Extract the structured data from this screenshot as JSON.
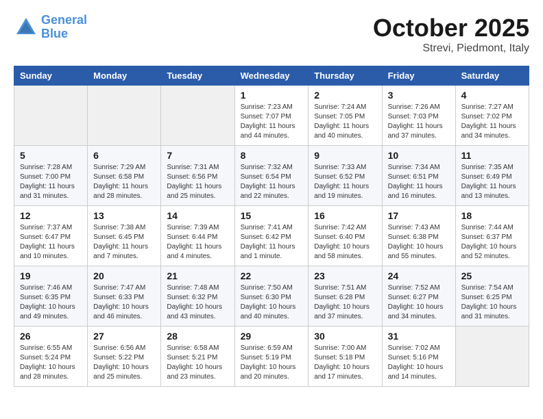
{
  "header": {
    "logo_line1": "General",
    "logo_line2": "Blue",
    "month": "October 2025",
    "location": "Strevi, Piedmont, Italy"
  },
  "weekdays": [
    "Sunday",
    "Monday",
    "Tuesday",
    "Wednesday",
    "Thursday",
    "Friday",
    "Saturday"
  ],
  "weeks": [
    [
      {
        "day": "",
        "info": ""
      },
      {
        "day": "",
        "info": ""
      },
      {
        "day": "",
        "info": ""
      },
      {
        "day": "1",
        "info": "Sunrise: 7:23 AM\nSunset: 7:07 PM\nDaylight: 11 hours and 44 minutes."
      },
      {
        "day": "2",
        "info": "Sunrise: 7:24 AM\nSunset: 7:05 PM\nDaylight: 11 hours and 40 minutes."
      },
      {
        "day": "3",
        "info": "Sunrise: 7:26 AM\nSunset: 7:03 PM\nDaylight: 11 hours and 37 minutes."
      },
      {
        "day": "4",
        "info": "Sunrise: 7:27 AM\nSunset: 7:02 PM\nDaylight: 11 hours and 34 minutes."
      }
    ],
    [
      {
        "day": "5",
        "info": "Sunrise: 7:28 AM\nSunset: 7:00 PM\nDaylight: 11 hours and 31 minutes."
      },
      {
        "day": "6",
        "info": "Sunrise: 7:29 AM\nSunset: 6:58 PM\nDaylight: 11 hours and 28 minutes."
      },
      {
        "day": "7",
        "info": "Sunrise: 7:31 AM\nSunset: 6:56 PM\nDaylight: 11 hours and 25 minutes."
      },
      {
        "day": "8",
        "info": "Sunrise: 7:32 AM\nSunset: 6:54 PM\nDaylight: 11 hours and 22 minutes."
      },
      {
        "day": "9",
        "info": "Sunrise: 7:33 AM\nSunset: 6:52 PM\nDaylight: 11 hours and 19 minutes."
      },
      {
        "day": "10",
        "info": "Sunrise: 7:34 AM\nSunset: 6:51 PM\nDaylight: 11 hours and 16 minutes."
      },
      {
        "day": "11",
        "info": "Sunrise: 7:35 AM\nSunset: 6:49 PM\nDaylight: 11 hours and 13 minutes."
      }
    ],
    [
      {
        "day": "12",
        "info": "Sunrise: 7:37 AM\nSunset: 6:47 PM\nDaylight: 11 hours and 10 minutes."
      },
      {
        "day": "13",
        "info": "Sunrise: 7:38 AM\nSunset: 6:45 PM\nDaylight: 11 hours and 7 minutes."
      },
      {
        "day": "14",
        "info": "Sunrise: 7:39 AM\nSunset: 6:44 PM\nDaylight: 11 hours and 4 minutes."
      },
      {
        "day": "15",
        "info": "Sunrise: 7:41 AM\nSunset: 6:42 PM\nDaylight: 11 hours and 1 minute."
      },
      {
        "day": "16",
        "info": "Sunrise: 7:42 AM\nSunset: 6:40 PM\nDaylight: 10 hours and 58 minutes."
      },
      {
        "day": "17",
        "info": "Sunrise: 7:43 AM\nSunset: 6:38 PM\nDaylight: 10 hours and 55 minutes."
      },
      {
        "day": "18",
        "info": "Sunrise: 7:44 AM\nSunset: 6:37 PM\nDaylight: 10 hours and 52 minutes."
      }
    ],
    [
      {
        "day": "19",
        "info": "Sunrise: 7:46 AM\nSunset: 6:35 PM\nDaylight: 10 hours and 49 minutes."
      },
      {
        "day": "20",
        "info": "Sunrise: 7:47 AM\nSunset: 6:33 PM\nDaylight: 10 hours and 46 minutes."
      },
      {
        "day": "21",
        "info": "Sunrise: 7:48 AM\nSunset: 6:32 PM\nDaylight: 10 hours and 43 minutes."
      },
      {
        "day": "22",
        "info": "Sunrise: 7:50 AM\nSunset: 6:30 PM\nDaylight: 10 hours and 40 minutes."
      },
      {
        "day": "23",
        "info": "Sunrise: 7:51 AM\nSunset: 6:28 PM\nDaylight: 10 hours and 37 minutes."
      },
      {
        "day": "24",
        "info": "Sunrise: 7:52 AM\nSunset: 6:27 PM\nDaylight: 10 hours and 34 minutes."
      },
      {
        "day": "25",
        "info": "Sunrise: 7:54 AM\nSunset: 6:25 PM\nDaylight: 10 hours and 31 minutes."
      }
    ],
    [
      {
        "day": "26",
        "info": "Sunrise: 6:55 AM\nSunset: 5:24 PM\nDaylight: 10 hours and 28 minutes."
      },
      {
        "day": "27",
        "info": "Sunrise: 6:56 AM\nSunset: 5:22 PM\nDaylight: 10 hours and 25 minutes."
      },
      {
        "day": "28",
        "info": "Sunrise: 6:58 AM\nSunset: 5:21 PM\nDaylight: 10 hours and 23 minutes."
      },
      {
        "day": "29",
        "info": "Sunrise: 6:59 AM\nSunset: 5:19 PM\nDaylight: 10 hours and 20 minutes."
      },
      {
        "day": "30",
        "info": "Sunrise: 7:00 AM\nSunset: 5:18 PM\nDaylight: 10 hours and 17 minutes."
      },
      {
        "day": "31",
        "info": "Sunrise: 7:02 AM\nSunset: 5:16 PM\nDaylight: 10 hours and 14 minutes."
      },
      {
        "day": "",
        "info": ""
      }
    ]
  ]
}
